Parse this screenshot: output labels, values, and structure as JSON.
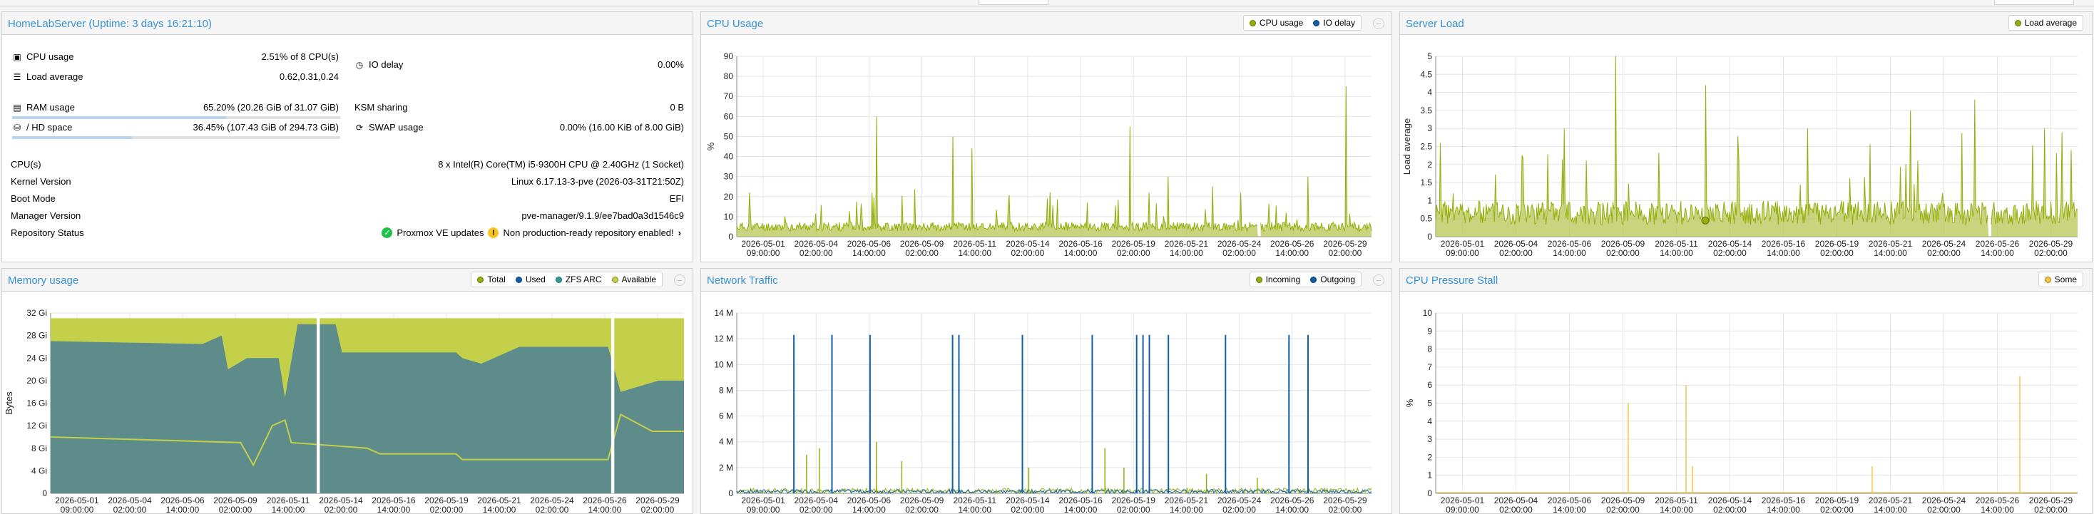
{
  "status": {
    "title": "HomeLabServer (Uptime: 3 days 16:21:10)",
    "cpu": {
      "label": "CPU usage",
      "value": "2.51% of 8 CPU(s)"
    },
    "load": {
      "label": "Load average",
      "value": "0.62,0.31,0.24"
    },
    "iodelay": {
      "label": "IO delay",
      "value": "0.00%"
    },
    "ram": {
      "label": "RAM usage",
      "value": "65.20% (20.26 GiB of 31.07 GiB)",
      "fraction": 0.652
    },
    "ksm": {
      "label": "KSM sharing",
      "value": "0 B"
    },
    "hd": {
      "label": "/ HD space",
      "value": "36.45% (107.43 GiB of 294.73 GiB)",
      "fraction": 0.3645
    },
    "swap": {
      "label": "SWAP usage",
      "value": "0.00% (16.00 KiB of 8.00 GiB)"
    },
    "cpus": {
      "label": "CPU(s)",
      "value": "8 x Intel(R) Core(TM) i5-9300H CPU @ 2.40GHz (1 Socket)"
    },
    "kernel": {
      "label": "Kernel Version",
      "value": "Linux 6.17.13-3-pve (2026-03-31T21:50Z)"
    },
    "boot": {
      "label": "Boot Mode",
      "value": "EFI"
    },
    "manager": {
      "label": "Manager Version",
      "value": "pve-manager/9.1.9/ee7bad0a3d1546c9"
    },
    "repo": {
      "label": "Repository Status",
      "updates": "Proxmox VE updates",
      "warning": "Non production-ready repository enabled!"
    }
  },
  "panels": {
    "cpu": {
      "title": "CPU Usage",
      "legend": [
        "CPU usage",
        "IO delay"
      ]
    },
    "load": {
      "title": "Server Load",
      "legend": [
        "Load average"
      ]
    },
    "memory": {
      "title": "Memory usage",
      "legend": [
        "Total",
        "Used",
        "ZFS ARC",
        "Available"
      ]
    },
    "network": {
      "title": "Network Traffic",
      "legend": [
        "Incoming",
        "Outgoing"
      ]
    },
    "pressure": {
      "title": "CPU Pressure Stall",
      "legend": [
        "Some"
      ]
    }
  },
  "colors": {
    "cpu_fill": "#b5c553",
    "cpu_line": "#94ae0a",
    "io": "#115fa6",
    "mem_total": "#b5c553",
    "mem_used": "#5d8c8a",
    "mem_arc": "#2e9e8f",
    "mem_avail": "#c4d04a",
    "net_in": "#94ae0a",
    "net_out": "#115fa6",
    "pressure": "#f5c542",
    "title": "#3892d4"
  },
  "chart_data": [
    {
      "id": "cpu",
      "type": "area",
      "ylabel": "%",
      "ylim": [
        0,
        90
      ],
      "yticks": [
        0,
        10,
        20,
        30,
        40,
        50,
        60,
        70,
        80,
        90
      ],
      "xticks": [
        [
          "2026-05-01",
          "09:00:00"
        ],
        [
          "2026-05-04",
          "02:00:00"
        ],
        [
          "2026-05-06",
          "14:00:00"
        ],
        [
          "2026-05-09",
          "02:00:00"
        ],
        [
          "2026-05-11",
          "14:00:00"
        ],
        [
          "2026-05-14",
          "02:00:00"
        ],
        [
          "2026-05-16",
          "14:00:00"
        ],
        [
          "2026-05-19",
          "02:00:00"
        ],
        [
          "2026-05-21",
          "14:00:00"
        ],
        [
          "2026-05-24",
          "02:00:00"
        ],
        [
          "2026-05-26",
          "14:00:00"
        ],
        [
          "2026-05-29",
          "02:00:00"
        ]
      ],
      "baseline": 5,
      "spikes": [
        [
          0.02,
          22
        ],
        [
          0.22,
          60
        ],
        [
          0.34,
          50
        ],
        [
          0.37,
          44
        ],
        [
          0.5,
          30
        ],
        [
          0.62,
          55
        ],
        [
          0.68,
          30
        ],
        [
          0.75,
          25
        ],
        [
          0.9,
          30
        ],
        [
          0.96,
          75
        ]
      ],
      "gaps": [
        [
          0.82,
          0.825
        ]
      ]
    },
    {
      "id": "load",
      "type": "area",
      "ylabel": "Load average",
      "ylim": [
        0,
        5
      ],
      "yticks": [
        0,
        0.5,
        1,
        1.5,
        2,
        2.5,
        3,
        3.5,
        4,
        4.5,
        5
      ],
      "xticks": [
        [
          "2026-05-01",
          "09:00:00"
        ],
        [
          "2026-05-04",
          "02:00:00"
        ],
        [
          "2026-05-06",
          "14:00:00"
        ],
        [
          "2026-05-09",
          "02:00:00"
        ],
        [
          "2026-05-11",
          "14:00:00"
        ],
        [
          "2026-05-14",
          "02:00:00"
        ],
        [
          "2026-05-16",
          "14:00:00"
        ],
        [
          "2026-05-19",
          "02:00:00"
        ],
        [
          "2026-05-21",
          "14:00:00"
        ],
        [
          "2026-05-24",
          "02:00:00"
        ],
        [
          "2026-05-26",
          "14:00:00"
        ],
        [
          "2026-05-29",
          "02:00:00"
        ]
      ],
      "baseline": 0.6,
      "spikes": [
        [
          0.2,
          3
        ],
        [
          0.28,
          5
        ],
        [
          0.42,
          4.2
        ],
        [
          0.58,
          3
        ],
        [
          0.74,
          3.5
        ],
        [
          0.84,
          3.8
        ],
        [
          0.99,
          2.4
        ]
      ],
      "gaps": [
        [
          0.86,
          0.865
        ]
      ]
    },
    {
      "id": "memory",
      "type": "area",
      "ylabel": "Bytes",
      "ylim": [
        0,
        32
      ],
      "yticks": [
        "0",
        "4 Gi",
        "8 Gi",
        "12 Gi",
        "16 Gi",
        "20 Gi",
        "24 Gi",
        "28 Gi",
        "32 Gi"
      ],
      "xticks": [
        [
          "2026-05-01",
          "09:00:00"
        ],
        [
          "2026-05-04",
          "02:00:00"
        ],
        [
          "2026-05-06",
          "14:00:00"
        ],
        [
          "2026-05-09",
          "02:00:00"
        ],
        [
          "2026-05-11",
          "14:00:00"
        ],
        [
          "2026-05-14",
          "02:00:00"
        ],
        [
          "2026-05-16",
          "14:00:00"
        ],
        [
          "2026-05-19",
          "02:00:00"
        ],
        [
          "2026-05-21",
          "14:00:00"
        ],
        [
          "2026-05-24",
          "02:00:00"
        ],
        [
          "2026-05-26",
          "14:00:00"
        ],
        [
          "2026-05-29",
          "02:00:00"
        ]
      ],
      "total": 31.07,
      "used": [
        [
          0,
          27
        ],
        [
          0.24,
          26.5
        ],
        [
          0.27,
          28
        ],
        [
          0.28,
          22
        ],
        [
          0.31,
          24
        ],
        [
          0.36,
          24
        ],
        [
          0.37,
          17
        ],
        [
          0.39,
          30
        ],
        [
          0.45,
          30
        ],
        [
          0.46,
          25
        ],
        [
          0.64,
          25
        ],
        [
          0.65,
          24
        ],
        [
          0.68,
          23
        ],
        [
          0.74,
          26
        ],
        [
          0.88,
          26
        ],
        [
          0.9,
          18
        ],
        [
          0.96,
          20
        ],
        [
          1,
          20
        ]
      ],
      "arc": [
        [
          0,
          10
        ],
        [
          0.3,
          9
        ],
        [
          0.32,
          5
        ],
        [
          0.35,
          12
        ],
        [
          0.37,
          13
        ],
        [
          0.38,
          9
        ],
        [
          0.5,
          8
        ],
        [
          0.52,
          7
        ],
        [
          0.64,
          7
        ],
        [
          0.65,
          6
        ],
        [
          0.88,
          6
        ],
        [
          0.9,
          14
        ],
        [
          0.95,
          11
        ],
        [
          1,
          11
        ]
      ],
      "gaps": [
        [
          0.42,
          0.425
        ],
        [
          0.885,
          0.89
        ]
      ]
    },
    {
      "id": "network",
      "type": "line",
      "ylim": [
        0,
        14
      ],
      "yticks": [
        "0",
        "2 M",
        "4 M",
        "6 M",
        "8 M",
        "10 M",
        "12 M",
        "14 M"
      ],
      "xticks": [
        [
          "2026-05-01",
          "09:00:00"
        ],
        [
          "2026-05-04",
          "02:00:00"
        ],
        [
          "2026-05-06",
          "14:00:00"
        ],
        [
          "2026-05-09",
          "02:00:00"
        ],
        [
          "2026-05-11",
          "14:00:00"
        ],
        [
          "2026-05-14",
          "02:00:00"
        ],
        [
          "2026-05-16",
          "14:00:00"
        ],
        [
          "2026-05-19",
          "02:00:00"
        ],
        [
          "2026-05-21",
          "14:00:00"
        ],
        [
          "2026-05-24",
          "02:00:00"
        ],
        [
          "2026-05-26",
          "14:00:00"
        ],
        [
          "2026-05-29",
          "02:00:00"
        ]
      ],
      "outgoing_spikes": [
        0.09,
        0.15,
        0.21,
        0.34,
        0.35,
        0.45,
        0.56,
        0.63,
        0.64,
        0.65,
        0.68,
        0.77,
        0.87,
        0.9
      ],
      "incoming_spikes": [
        [
          0.11,
          3
        ],
        [
          0.13,
          3.5
        ],
        [
          0.22,
          4
        ],
        [
          0.26,
          2.5
        ],
        [
          0.46,
          2
        ],
        [
          0.58,
          3.5
        ],
        [
          0.61,
          2
        ],
        [
          0.74,
          1.5
        ],
        [
          0.82,
          1.2
        ]
      ]
    },
    {
      "id": "pressure",
      "type": "line",
      "ylabel": "%",
      "ylim": [
        0,
        10
      ],
      "yticks": [
        0,
        1,
        2,
        3,
        4,
        5,
        6,
        7,
        8,
        9,
        10
      ],
      "xticks": [
        [
          "2026-05-01",
          "09:00:00"
        ],
        [
          "2026-05-04",
          "02:00:00"
        ],
        [
          "2026-05-06",
          "14:00:00"
        ],
        [
          "2026-05-09",
          "02:00:00"
        ],
        [
          "2026-05-11",
          "14:00:00"
        ],
        [
          "2026-05-14",
          "02:00:00"
        ],
        [
          "2026-05-16",
          "14:00:00"
        ],
        [
          "2026-05-19",
          "02:00:00"
        ],
        [
          "2026-05-21",
          "14:00:00"
        ],
        [
          "2026-05-24",
          "02:00:00"
        ],
        [
          "2026-05-26",
          "14:00:00"
        ],
        [
          "2026-05-29",
          "02:00:00"
        ]
      ],
      "spikes": [
        [
          0.3,
          5
        ],
        [
          0.39,
          6
        ],
        [
          0.4,
          1.5
        ],
        [
          0.68,
          1.5
        ],
        [
          0.91,
          6.5
        ]
      ]
    }
  ]
}
